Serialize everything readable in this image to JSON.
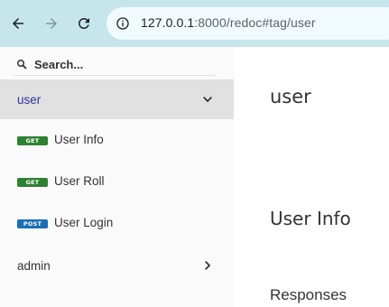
{
  "browser": {
    "url_host": "127.0.0.1",
    "url_rest": ":8000/redoc#tag/user"
  },
  "sidebar": {
    "search_placeholder": "Search...",
    "groups": [
      {
        "label": "user",
        "expanded": true,
        "active": true
      },
      {
        "label": "admin",
        "expanded": false,
        "active": false
      }
    ],
    "operations": [
      {
        "method": "GET",
        "label": "User Info"
      },
      {
        "method": "GET",
        "label": "User Roll"
      },
      {
        "method": "POST",
        "label": "User Login"
      }
    ]
  },
  "main": {
    "tag_title": "user",
    "operation_title": "User Info",
    "responses_title": "Responses"
  },
  "colors": {
    "toolbar": "#c7e6ec",
    "get_badge": "#2f8132",
    "post_badge": "#186fb7",
    "active_label": "#32329f"
  }
}
